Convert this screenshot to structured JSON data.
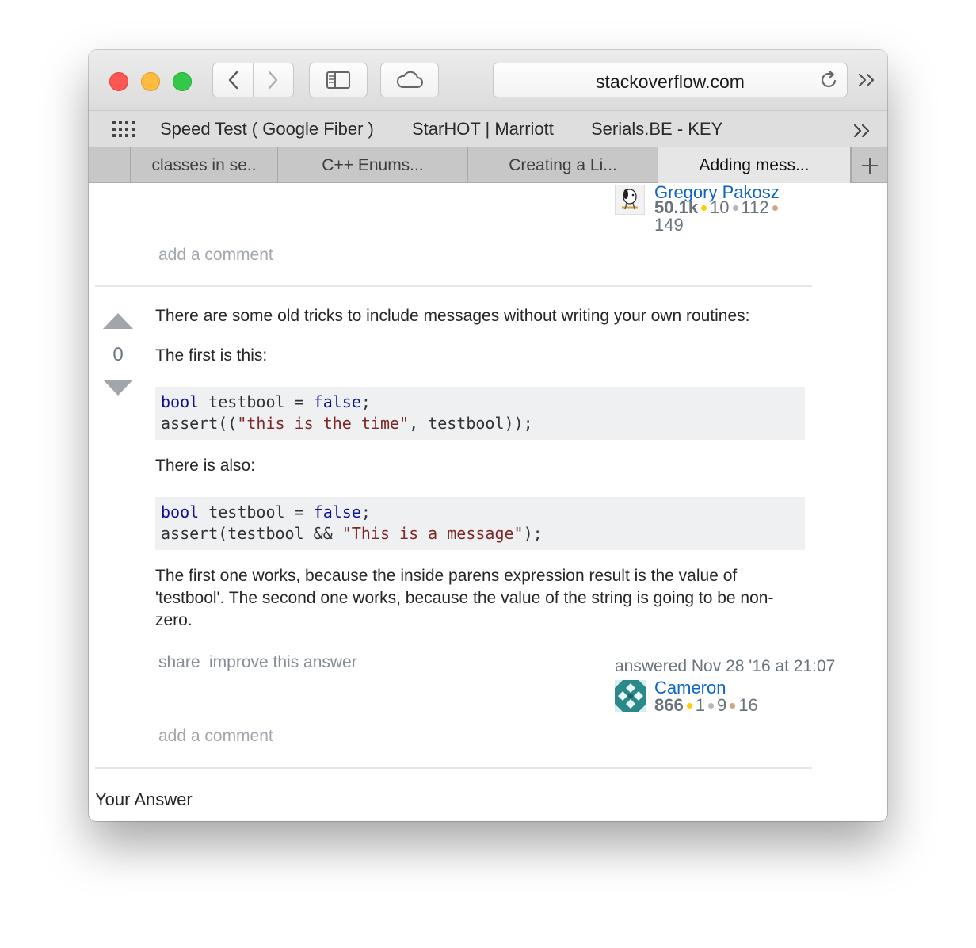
{
  "toolbar": {
    "address": "stackoverflow.com"
  },
  "bookmarks": [
    {
      "label": "Speed Test ( Google Fiber )"
    },
    {
      "label": "StarHOT | Marriott"
    },
    {
      "label": "Serials.BE - KEY"
    }
  ],
  "tabs": [
    {
      "label": "classes in se..",
      "active": false
    },
    {
      "label": "C++ Enums...",
      "active": false
    },
    {
      "label": "Creating a Li...",
      "active": false
    },
    {
      "label": "Adding mess...",
      "active": true
    }
  ],
  "prev_answer": {
    "user": {
      "name": "Gregory Pakosz",
      "reputation": "50.1k",
      "gold": "10",
      "silver": "112",
      "bronze": "149"
    },
    "add_comment": "add a comment"
  },
  "answer": {
    "votes": "0",
    "intro": "There are some old tricks to include messages without writing your own routines:",
    "first_label": "The first is this:",
    "code1": {
      "line1": {
        "kw1": "bool",
        "mid": " testbool = ",
        "kw2": "false",
        "end": ";"
      },
      "line2": {
        "start": "assert((",
        "str": "\"this is the time\"",
        "end": ", testbool));"
      }
    },
    "also_label": "There is also:",
    "code2": {
      "line1": {
        "kw1": "bool",
        "mid": " testbool = ",
        "kw2": "false",
        "end": ";"
      },
      "line2": {
        "start": "assert(testbool && ",
        "str": "\"This is a message\"",
        "end": ");"
      }
    },
    "explanation": "The first one works, because the inside parens expression result is the value of 'testbool'. The second one works, because the value of the string is going to be non-zero.",
    "share": "share",
    "improve": "improve this answer",
    "answered": "answered Nov 28 '16 at 21:07",
    "user": {
      "name": "Cameron",
      "reputation": "866",
      "gold": "1",
      "silver": "9",
      "bronze": "16"
    },
    "add_comment": "add a comment"
  },
  "your_answer_heading": "Your Answer",
  "colors": {
    "link": "#0c65c4",
    "muted": "#a0a6ab",
    "code_bg": "#eff0f1",
    "code_keyword": "#101094",
    "code_string": "#7d2727"
  }
}
